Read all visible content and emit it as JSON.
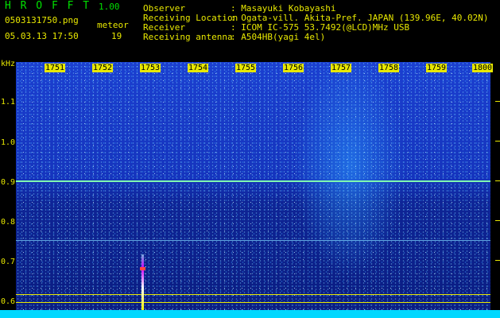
{
  "header": {
    "app_title": "H R O F F T",
    "version": "1.00",
    "filename": "0503131750.png",
    "mode_label": "meteor",
    "timestamp": "05.03.13 17:50",
    "count": "19",
    "info_rows": [
      {
        "label": "Observer",
        "value": ": Masayuki Kobayashi"
      },
      {
        "label": "Receiving Location",
        "value": ": Ogata-vill. Akita-Pref. JAPAN (139.96E, 40.02N)"
      },
      {
        "label": "Receiver",
        "value": ": ICOM IC-575 53.7492(@LCD)MHz USB"
      },
      {
        "label": "Receiving antenna",
        "value": ": A504HB(yagi 4el)"
      }
    ]
  },
  "axis": {
    "y_unit": "kHz",
    "y_ticks": [
      "1.1",
      "1.0",
      "0.9",
      "0.8",
      "0.7",
      "0.6"
    ],
    "x_ticks": [
      "1751",
      "1752",
      "1753",
      "1754",
      "1755",
      "1756",
      "1757",
      "1758",
      "1759",
      "1800"
    ]
  },
  "colors": {
    "accent_green": "#00e000",
    "label_yellow": "#e8e800",
    "signal_cyan": "#00d8ff",
    "background_blue": "#1534bd"
  }
}
